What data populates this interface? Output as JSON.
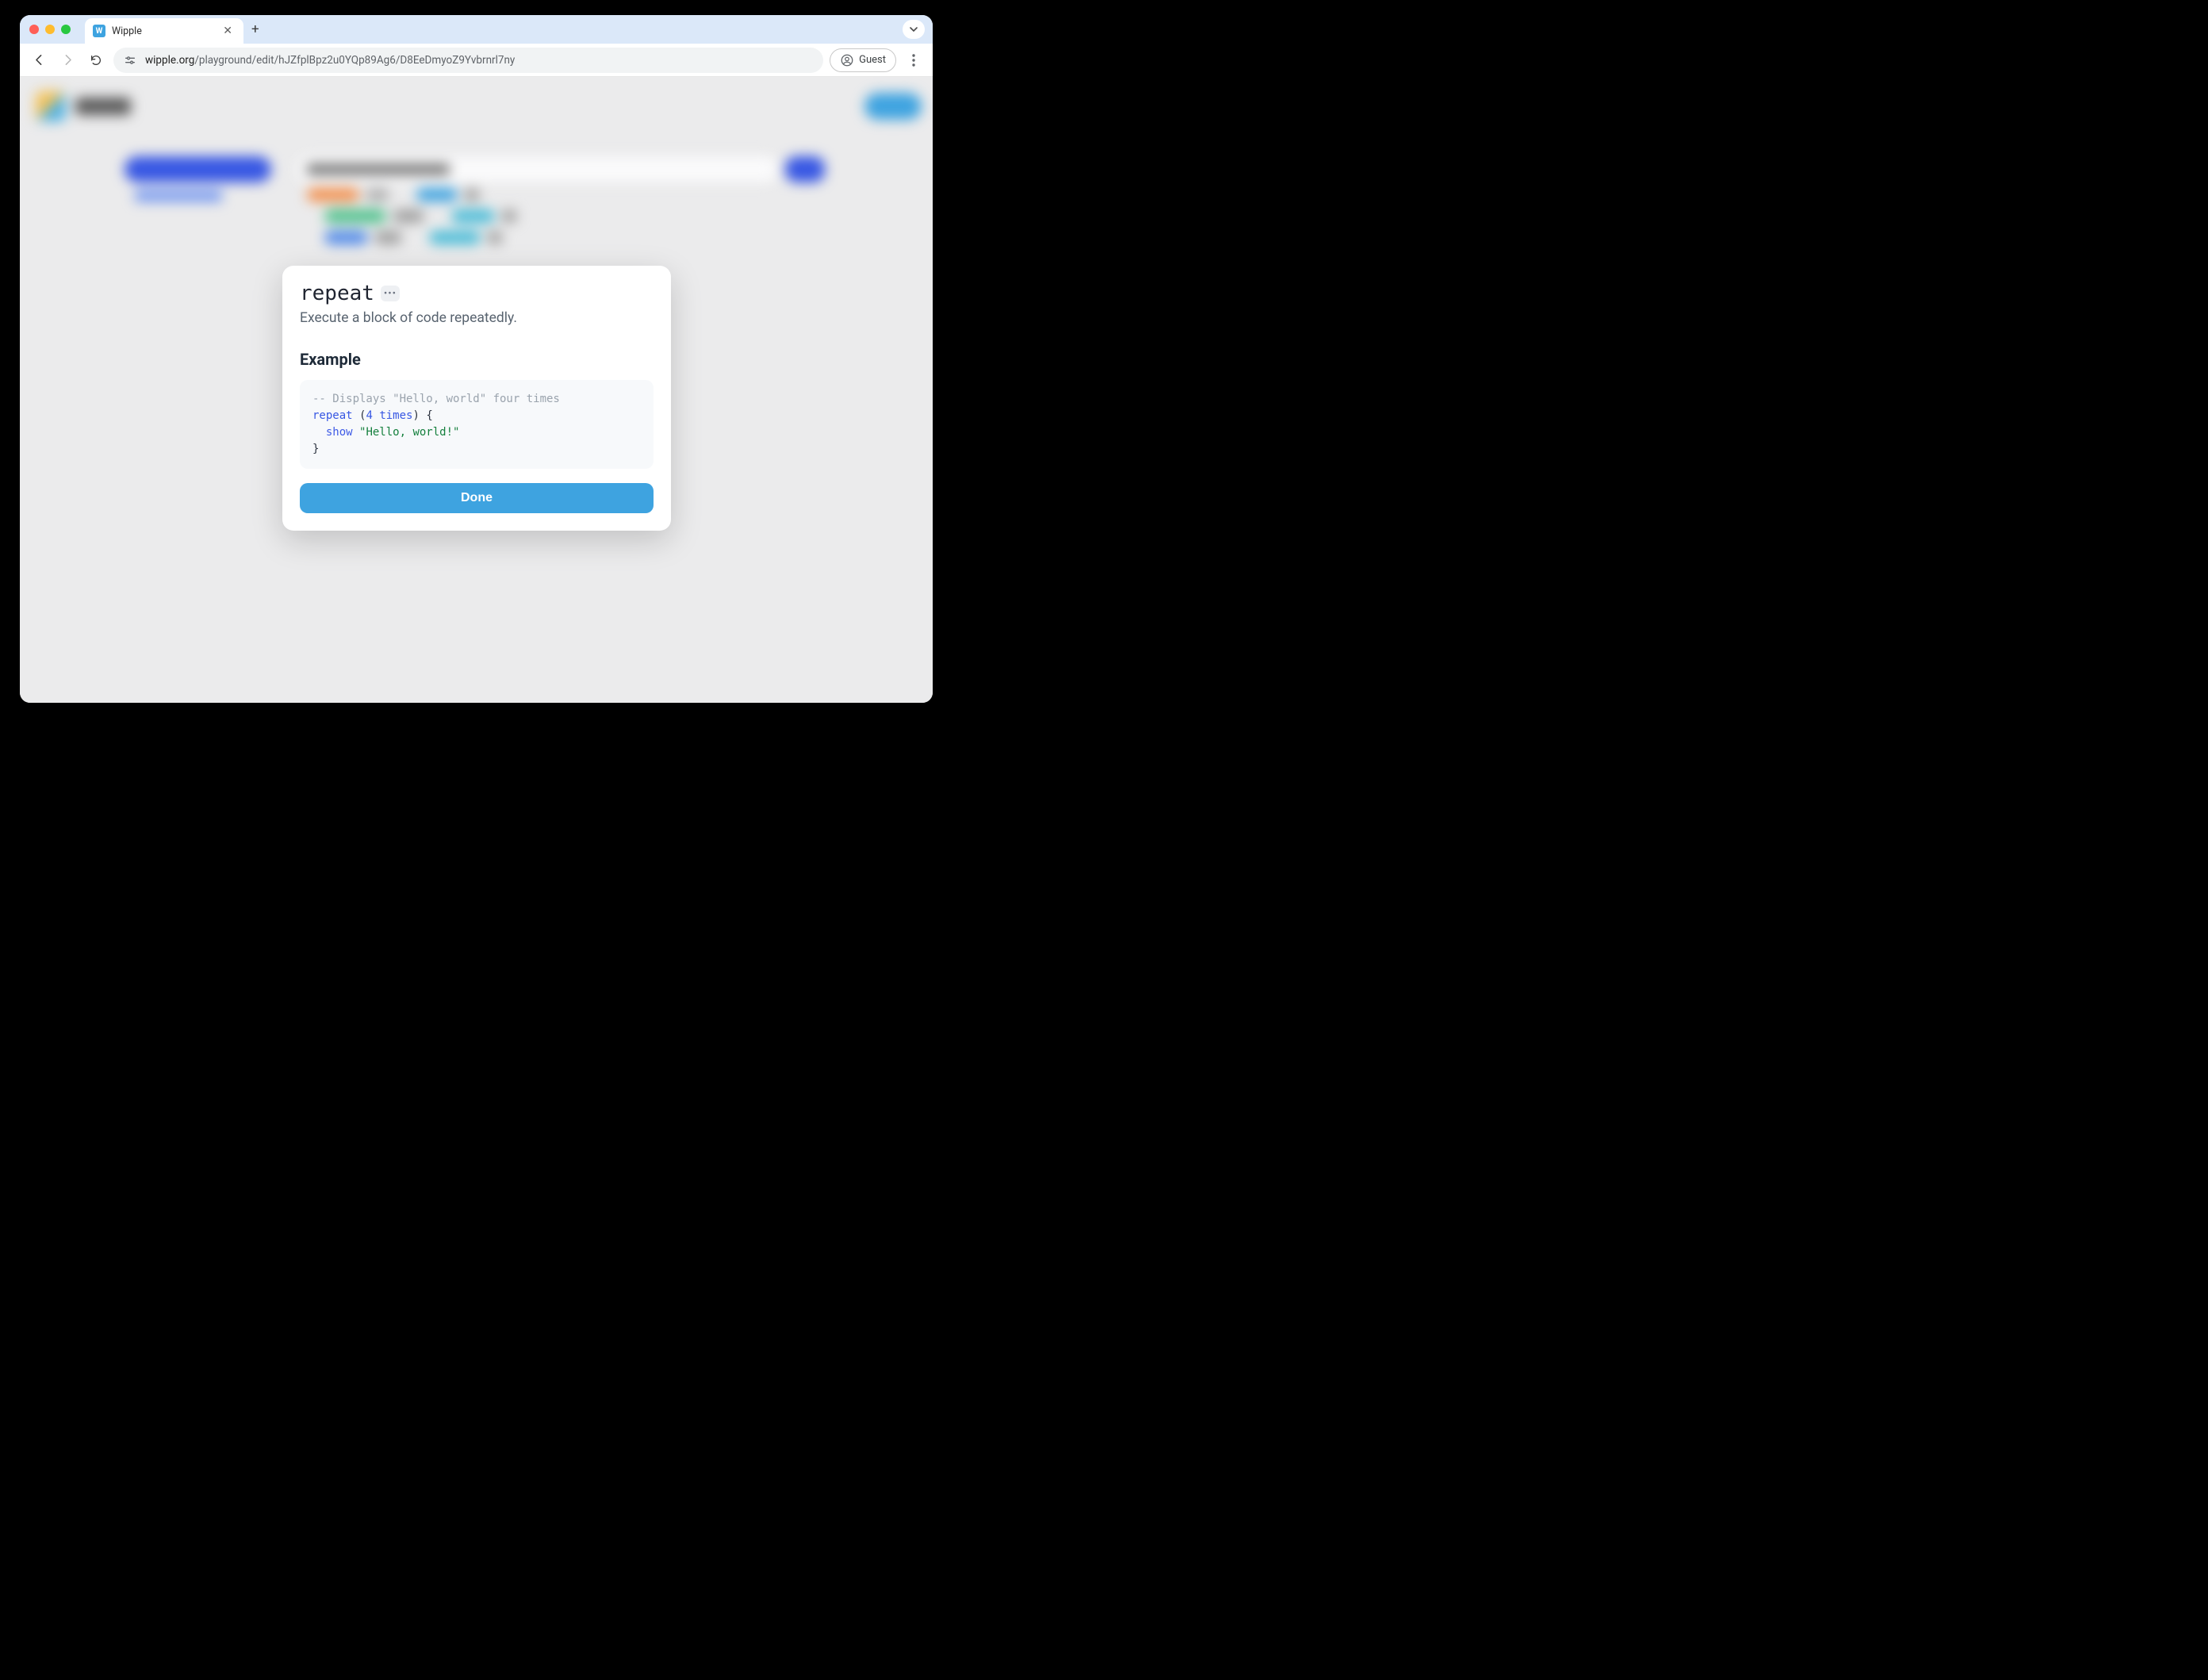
{
  "browser": {
    "tab_title": "Wipple",
    "favicon_letter": "W",
    "url_host": "wipple.org",
    "url_path": "/playground/edit/hJZfplBpz2u0YQp89Ag6/D8EeDmyoZ9Yvbrnrl7ny",
    "guest_label": "Guest"
  },
  "modal": {
    "keyword": "repeat",
    "description": "Execute a block of code repeatedly.",
    "example_heading": "Example",
    "code": {
      "comment": "-- Displays \"Hello, world\" four times",
      "line2_kw": "repeat",
      "line2_open": " (",
      "line2_num": "4",
      "line2_sp": " ",
      "line2_unit": "times",
      "line2_close": ") {",
      "line3_indent": "  ",
      "line3_fn": "show",
      "line3_sp": " ",
      "line3_str": "\"Hello, world!\"",
      "line4": "}"
    },
    "done_label": "Done"
  }
}
